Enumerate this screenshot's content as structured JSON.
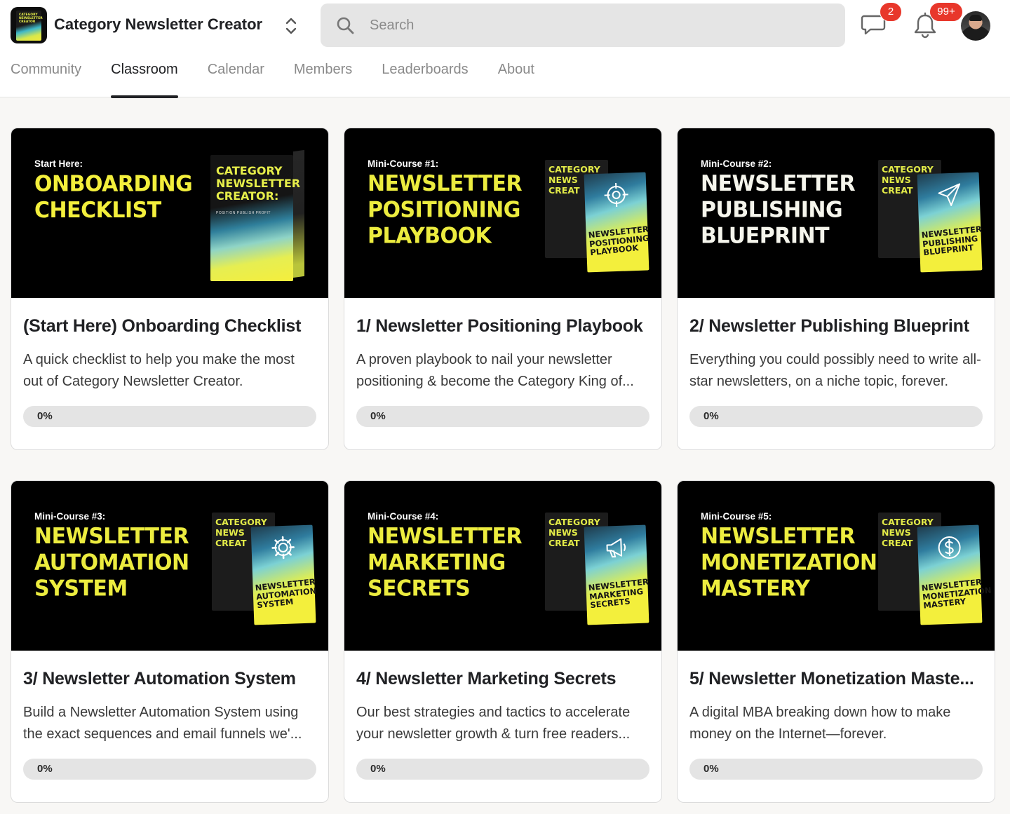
{
  "header": {
    "group_name": "Category Newsletter Creator",
    "logo_text": "CATEGORY\nNEWSLETTER\nCREATOR",
    "search_placeholder": "Search",
    "chat_badge": "2",
    "notifications_badge": "99+"
  },
  "tabs": [
    {
      "label": "Community",
      "active": false
    },
    {
      "label": "Classroom",
      "active": true
    },
    {
      "label": "Calendar",
      "active": false
    },
    {
      "label": "Members",
      "active": false
    },
    {
      "label": "Leaderboards",
      "active": false
    },
    {
      "label": "About",
      "active": false
    }
  ],
  "courses": [
    {
      "kicker": "Start Here:",
      "cover_title": "ONBOARDING\nCHECKLIST",
      "box_text": "CATEGORY\nNEWSLETTER\nCREATOR:",
      "box_sub": "POSITION  PUBLISH  PROFIT",
      "title": "(Start Here) Onboarding Checklist",
      "description": "A quick checklist to help you make the most out of Category Newsletter Creator.",
      "progress_label": "0%",
      "progress": 0
    },
    {
      "kicker": "Mini-Course #1:",
      "cover_title": "NEWSLETTER\nPOSITIONING\nPLAYBOOK",
      "box_text": "CATEGORY\nNEWS\nCREAT",
      "box_front_text": "NEWSLETTER\nPOSITIONING\nPLAYBOOK",
      "icon": "target-icon",
      "title": "1/ Newsletter Positioning Playbook",
      "description": "A proven playbook to nail your newsletter positioning & become the Category King of...",
      "progress_label": "0%",
      "progress": 0
    },
    {
      "kicker": "Mini-Course #2:",
      "cover_title": "NEWSLETTER\nPUBLISHING\nBLUEPRINT",
      "box_text": "CATEGORY\nNEWS\nCREAT",
      "box_front_text": "NEWSLETTER\nPUBLISHING\nBLUEPRINT",
      "icon": "paper-plane-icon",
      "title": "2/ Newsletter Publishing Blueprint",
      "description": "Everything you could possibly need to write all-star newsletters, on a niche topic, forever.",
      "progress_label": "0%",
      "progress": 0
    },
    {
      "kicker": "Mini-Course #3:",
      "cover_title": "NEWSLETTER\nAUTOMATION\nSYSTEM",
      "box_text": "CATEGORY\nNEWS\nCREAT",
      "box_front_text": "NEWSLETTER\nAUTOMATION\nSYSTEM",
      "icon": "gear-icon",
      "title": "3/ Newsletter Automation System",
      "description": "Build a Newsletter Automation System using the exact sequences and email funnels we'...",
      "progress_label": "0%",
      "progress": 0
    },
    {
      "kicker": "Mini-Course #4:",
      "cover_title": "NEWSLETTER\nMARKETING\nSECRETS",
      "box_text": "CATEGORY\nNEWS\nCREAT",
      "box_front_text": "NEWSLETTER\nMARKETING\nSECRETS",
      "icon": "megaphone-icon",
      "title": "4/ Newsletter Marketing Secrets",
      "description": "Our best strategies and tactics to accelerate your newsletter growth & turn free readers...",
      "progress_label": "0%",
      "progress": 0
    },
    {
      "kicker": "Mini-Course #5:",
      "cover_title": "NEWSLETTER\nMONETIZATION\nMASTERY",
      "box_text": "CATEGORY\nNEWS\nCREAT",
      "box_front_text": "NEWSLETTER\nMONETIZATION\nMASTERY",
      "icon": "dollar-coin-icon",
      "title": "5/ Newsletter Monetization Maste...",
      "description": "A digital MBA breaking down how to make money on the Internet—forever.",
      "progress_label": "0%",
      "progress": 0
    }
  ],
  "colors": {
    "accent_yellow": "#f3ef3c",
    "badge_red": "#e8372b",
    "progress_track": "#e4e4e4"
  }
}
